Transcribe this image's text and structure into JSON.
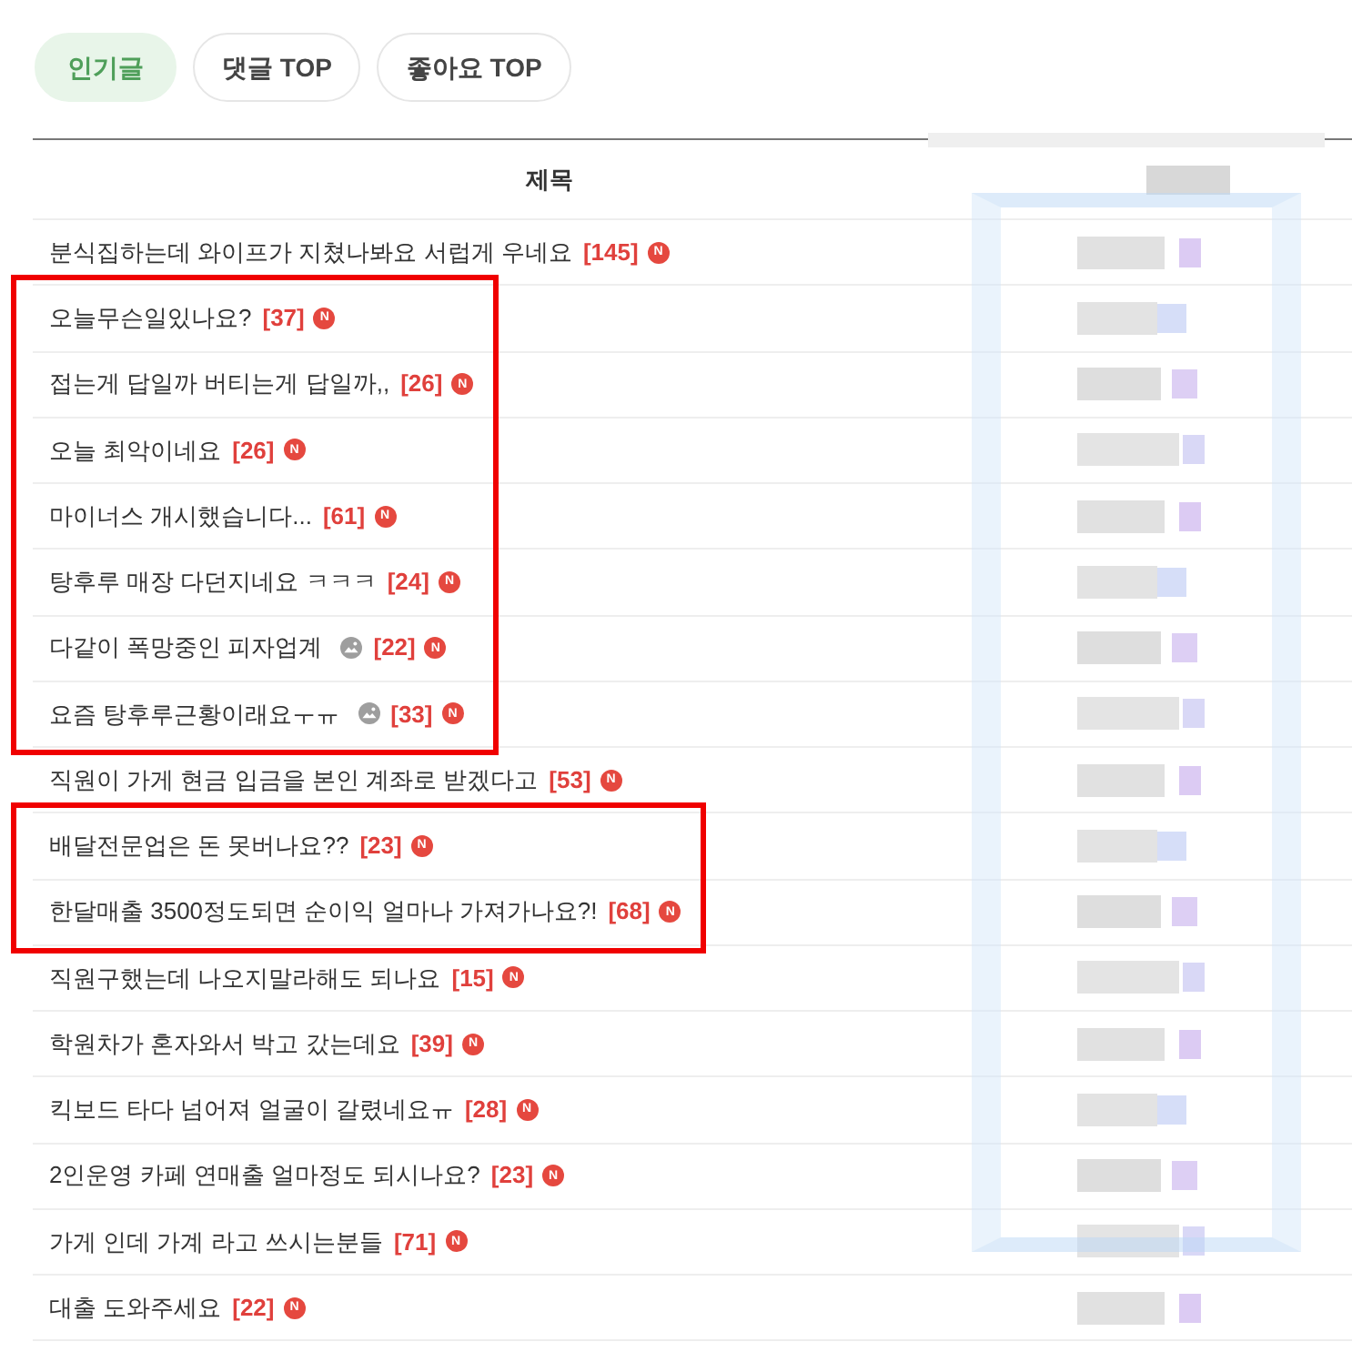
{
  "tabs": [
    {
      "label": "인기글",
      "selected": true
    },
    {
      "label": "댓글 TOP",
      "selected": false
    },
    {
      "label": "좋아요 TOP",
      "selected": false
    }
  ],
  "table": {
    "column_1": {
      "label": "제목"
    },
    "column_2": {
      "pixelated": true,
      "outlined": true
    },
    "groups": [
      {
        "annotated": false,
        "rows": [
          {
            "title": "분식집하는데 와이프가 지쳤나봐요 서럽게 우네요",
            "image": false,
            "comments": "[145]",
            "badge": "N"
          }
        ]
      },
      {
        "annotated": true,
        "rows": [
          {
            "title": "오늘무슨일있나요?",
            "image": false,
            "comments": "[37]",
            "badge": "N"
          },
          {
            "title": "접는게 답일까 버티는게 답일까,,",
            "image": false,
            "comments": "[26]",
            "badge": "N"
          },
          {
            "title": "오늘 최악이네요",
            "image": false,
            "comments": "[26]",
            "badge": "N"
          },
          {
            "title": "마이너스 개시했습니다...",
            "image": false,
            "comments": "[61]",
            "badge": "N"
          },
          {
            "title": "탕후루 매장 다던지네요 ㅋㅋㅋ",
            "image": false,
            "comments": "[24]",
            "badge": "N"
          },
          {
            "title": "다같이 폭망중인 피자업계",
            "image": true,
            "comments": "[22]",
            "badge": "N"
          },
          {
            "title": "요즘 탕후루근황이래요ㅜㅠ",
            "image": true,
            "comments": "[33]",
            "badge": "N"
          }
        ]
      },
      {
        "annotated": false,
        "rows": [
          {
            "title": "직원이 가게 현금 입금을 본인 계좌로 받겠다고",
            "image": false,
            "comments": "[53]",
            "badge": "N"
          }
        ]
      },
      {
        "annotated": true,
        "rows": [
          {
            "title": "배달전문업은 돈 못버나요??",
            "image": false,
            "comments": "[23]",
            "badge": "N"
          },
          {
            "title": "한달매출 3500정도되면 순이익 얼마나 가져가나요?!",
            "image": false,
            "comments": "[68]",
            "badge": "N"
          }
        ]
      },
      {
        "annotated": false,
        "rows": [
          {
            "title": "직원구했는데 나오지말라해도 되나요",
            "image": false,
            "comments": "[15]",
            "badge": "N"
          },
          {
            "title": "학원차가 혼자와서 박고 갔는데요",
            "image": false,
            "comments": "[39]",
            "badge": "N"
          },
          {
            "title": "킥보드 타다 넘어져 얼굴이 갈렸네요ㅠ",
            "image": false,
            "comments": "[28]",
            "badge": "N"
          },
          {
            "title": "2인운영 카페 연매출 얼마정도 되시나요?",
            "image": false,
            "comments": "[23]",
            "badge": "N"
          },
          {
            "title": "가게 인데 가계 라고 쓰시는분들",
            "image": false,
            "comments": "[71]",
            "badge": "N"
          },
          {
            "title": "대출 도와주세요",
            "image": false,
            "comments": "[22]",
            "badge": "N"
          }
        ]
      }
    ]
  }
}
